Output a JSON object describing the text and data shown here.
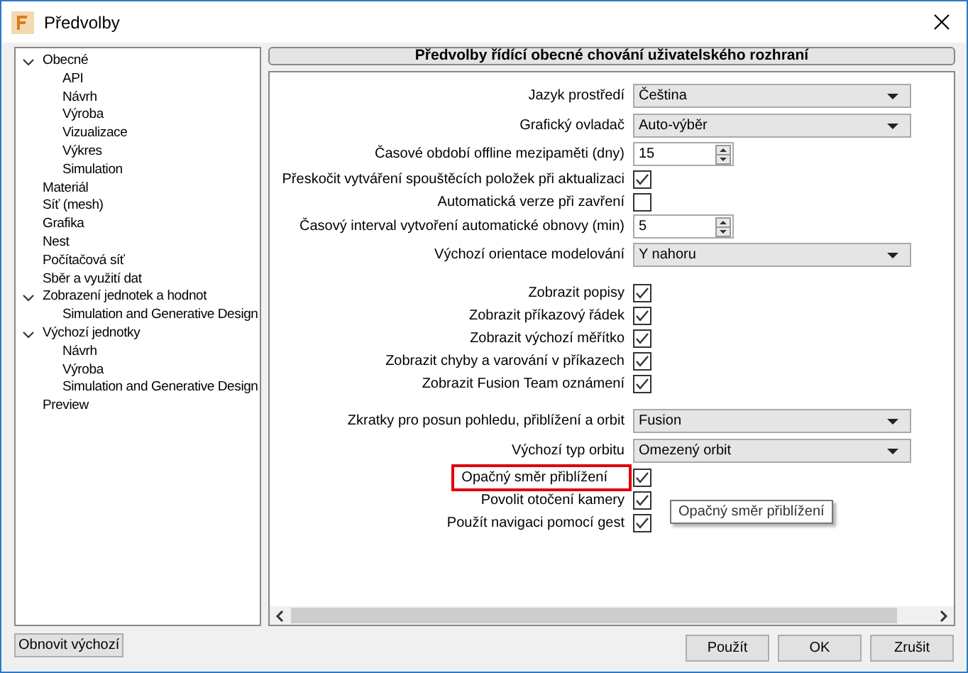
{
  "window": {
    "title": "Předvolby"
  },
  "tree": [
    {
      "label": "Obecné",
      "expanded": true,
      "children": [
        {
          "label": "API"
        },
        {
          "label": "Návrh"
        },
        {
          "label": "Výroba"
        },
        {
          "label": "Vizualizace"
        },
        {
          "label": "Výkres"
        },
        {
          "label": "Simulation"
        }
      ]
    },
    {
      "label": "Materiál"
    },
    {
      "label": "Síť (mesh)"
    },
    {
      "label": "Grafika"
    },
    {
      "label": "Nest"
    },
    {
      "label": "Počítačová síť"
    },
    {
      "label": "Sběr a využití dat"
    },
    {
      "label": "Zobrazení jednotek a hodnot",
      "expanded": true,
      "children": [
        {
          "label": "Simulation and Generative Design"
        }
      ]
    },
    {
      "label": "Výchozí jednotky",
      "expanded": true,
      "children": [
        {
          "label": "Návrh"
        },
        {
          "label": "Výroba"
        },
        {
          "label": "Simulation and Generative Design"
        }
      ]
    },
    {
      "label": "Preview"
    }
  ],
  "panel": {
    "title": "Předvolby řídící obecné chování uživatelského rozhraní"
  },
  "groups": [
    [
      {
        "kind": "dropdown",
        "label": "Jazyk prostředí",
        "value": "Čeština"
      },
      {
        "kind": "dropdown",
        "label": "Grafický ovladač",
        "value": "Auto-výběr"
      },
      {
        "kind": "spinner",
        "label": "Časové období offline mezipaměti (dny)",
        "value": "15"
      },
      {
        "kind": "checkbox",
        "label": "Přeskočit vytváření spouštěcích položek při aktualizaci",
        "checked": true
      },
      {
        "kind": "checkbox",
        "label": "Automatická verze při zavření",
        "checked": false
      },
      {
        "kind": "spinner",
        "label": "Časový interval vytvoření automatické obnovy (min)",
        "value": "5"
      },
      {
        "kind": "dropdown",
        "label": "Výchozí orientace modelování",
        "value": "Y nahoru"
      }
    ],
    [
      {
        "kind": "checkbox",
        "label": "Zobrazit popisy",
        "checked": true
      },
      {
        "kind": "checkbox",
        "label": "Zobrazit příkazový řádek",
        "checked": true
      },
      {
        "kind": "checkbox",
        "label": "Zobrazit výchozí měřítko",
        "checked": true
      },
      {
        "kind": "checkbox",
        "label": "Zobrazit chyby a varování v příkazech",
        "checked": true
      },
      {
        "kind": "checkbox",
        "label": "Zobrazit Fusion Team oznámení",
        "checked": true
      }
    ],
    [
      {
        "kind": "dropdown",
        "label": "Zkratky pro posun pohledu, přiblížení a orbit",
        "value": "Fusion"
      },
      {
        "kind": "dropdown",
        "label": "Výchozí typ orbitu",
        "value": "Omezený orbit"
      },
      {
        "kind": "checkbox",
        "label": "Opačný směr přiblížení",
        "checked": true,
        "highlighted": true
      },
      {
        "kind": "checkbox",
        "label": "Povolit otočení kamery",
        "checked": true
      },
      {
        "kind": "checkbox",
        "label": "Použít navigaci pomocí gest",
        "checked": true
      }
    ]
  ],
  "tooltip": "Opačný směr přiblížení",
  "buttons": {
    "reset": "Obnovit výchozí",
    "actions": [
      "Použít",
      "OK",
      "Zrušit"
    ]
  }
}
